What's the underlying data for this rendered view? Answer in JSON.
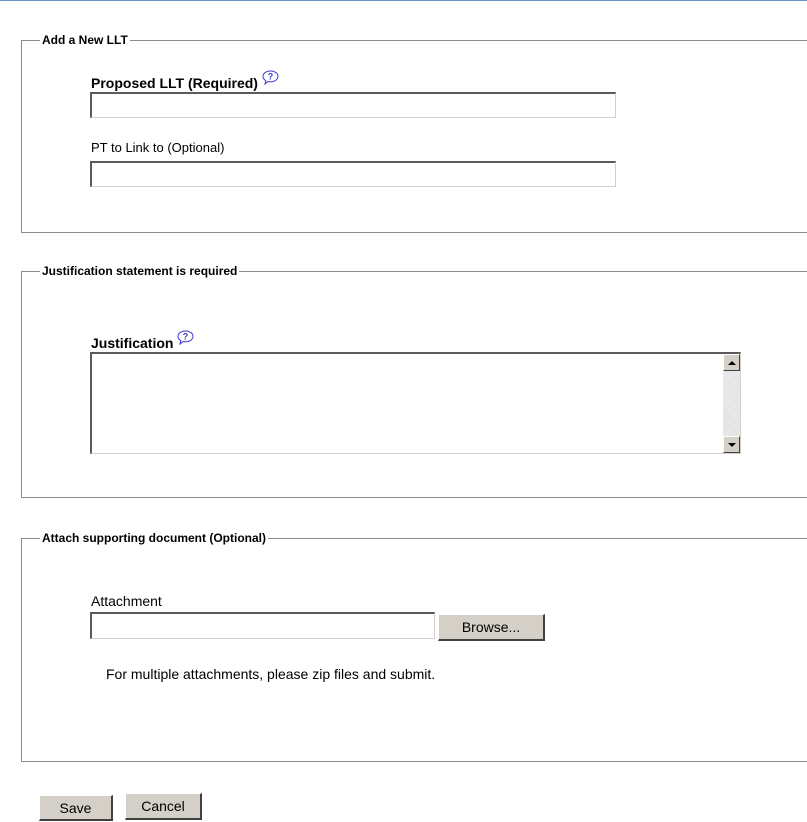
{
  "llt_section": {
    "legend": "Add a New LLT",
    "proposed_label": "Proposed LLT (Required)",
    "proposed_value": "",
    "pt_label": "PT to Link to (Optional)",
    "pt_value": ""
  },
  "justification_section": {
    "legend": "Justification statement is required",
    "label": "Justification",
    "value": ""
  },
  "attachment_section": {
    "legend": "Attach supporting document (Optional)",
    "label": "Attachment",
    "value": "",
    "browse_label": "Browse...",
    "note": "For multiple attachments, please zip files and submit."
  },
  "actions": {
    "save_label": "Save",
    "cancel_label": "Cancel"
  },
  "icons": {
    "help": "help-question-bubble-icon"
  },
  "colors": {
    "top_rule": "#6a92c6",
    "help_icon_fill": "#3a3ad0",
    "button_face": "#d4d0c8"
  }
}
